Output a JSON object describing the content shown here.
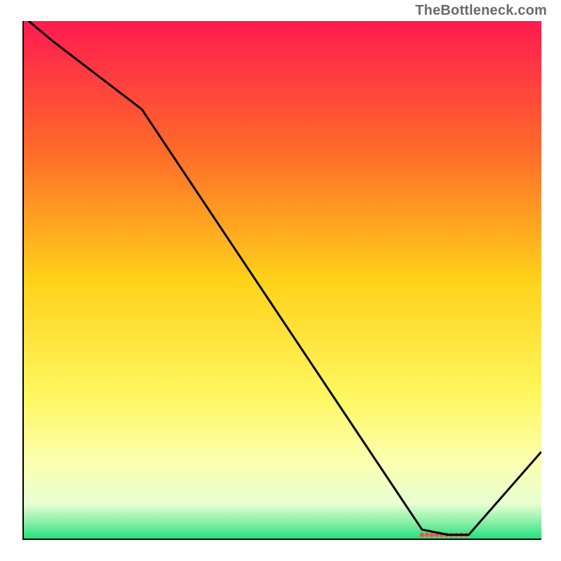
{
  "watermark": "TheBottleneck.com",
  "chart_data": {
    "type": "line",
    "title": "",
    "xlabel": "",
    "ylabel": "",
    "xlim": [
      0,
      100
    ],
    "ylim": [
      0,
      100
    ],
    "x": [
      0,
      6,
      23,
      77,
      82,
      86,
      100
    ],
    "values": [
      101,
      96,
      83,
      2,
      1,
      1,
      17
    ],
    "gradient_stops": [
      {
        "offset": 0.0,
        "color": "#ff1a50"
      },
      {
        "offset": 0.25,
        "color": "#ff6a2a"
      },
      {
        "offset": 0.5,
        "color": "#ffd21a"
      },
      {
        "offset": 0.72,
        "color": "#fff760"
      },
      {
        "offset": 0.85,
        "color": "#fbffb0"
      },
      {
        "offset": 0.93,
        "color": "#e8ffd2"
      },
      {
        "offset": 0.965,
        "color": "#8cf0a8"
      },
      {
        "offset": 1.0,
        "color": "#18e07a"
      }
    ],
    "axis_color": "#000000",
    "line_color": "#000000",
    "marker_color": "#ff4d4d",
    "marker_x_range": [
      77,
      86
    ]
  }
}
